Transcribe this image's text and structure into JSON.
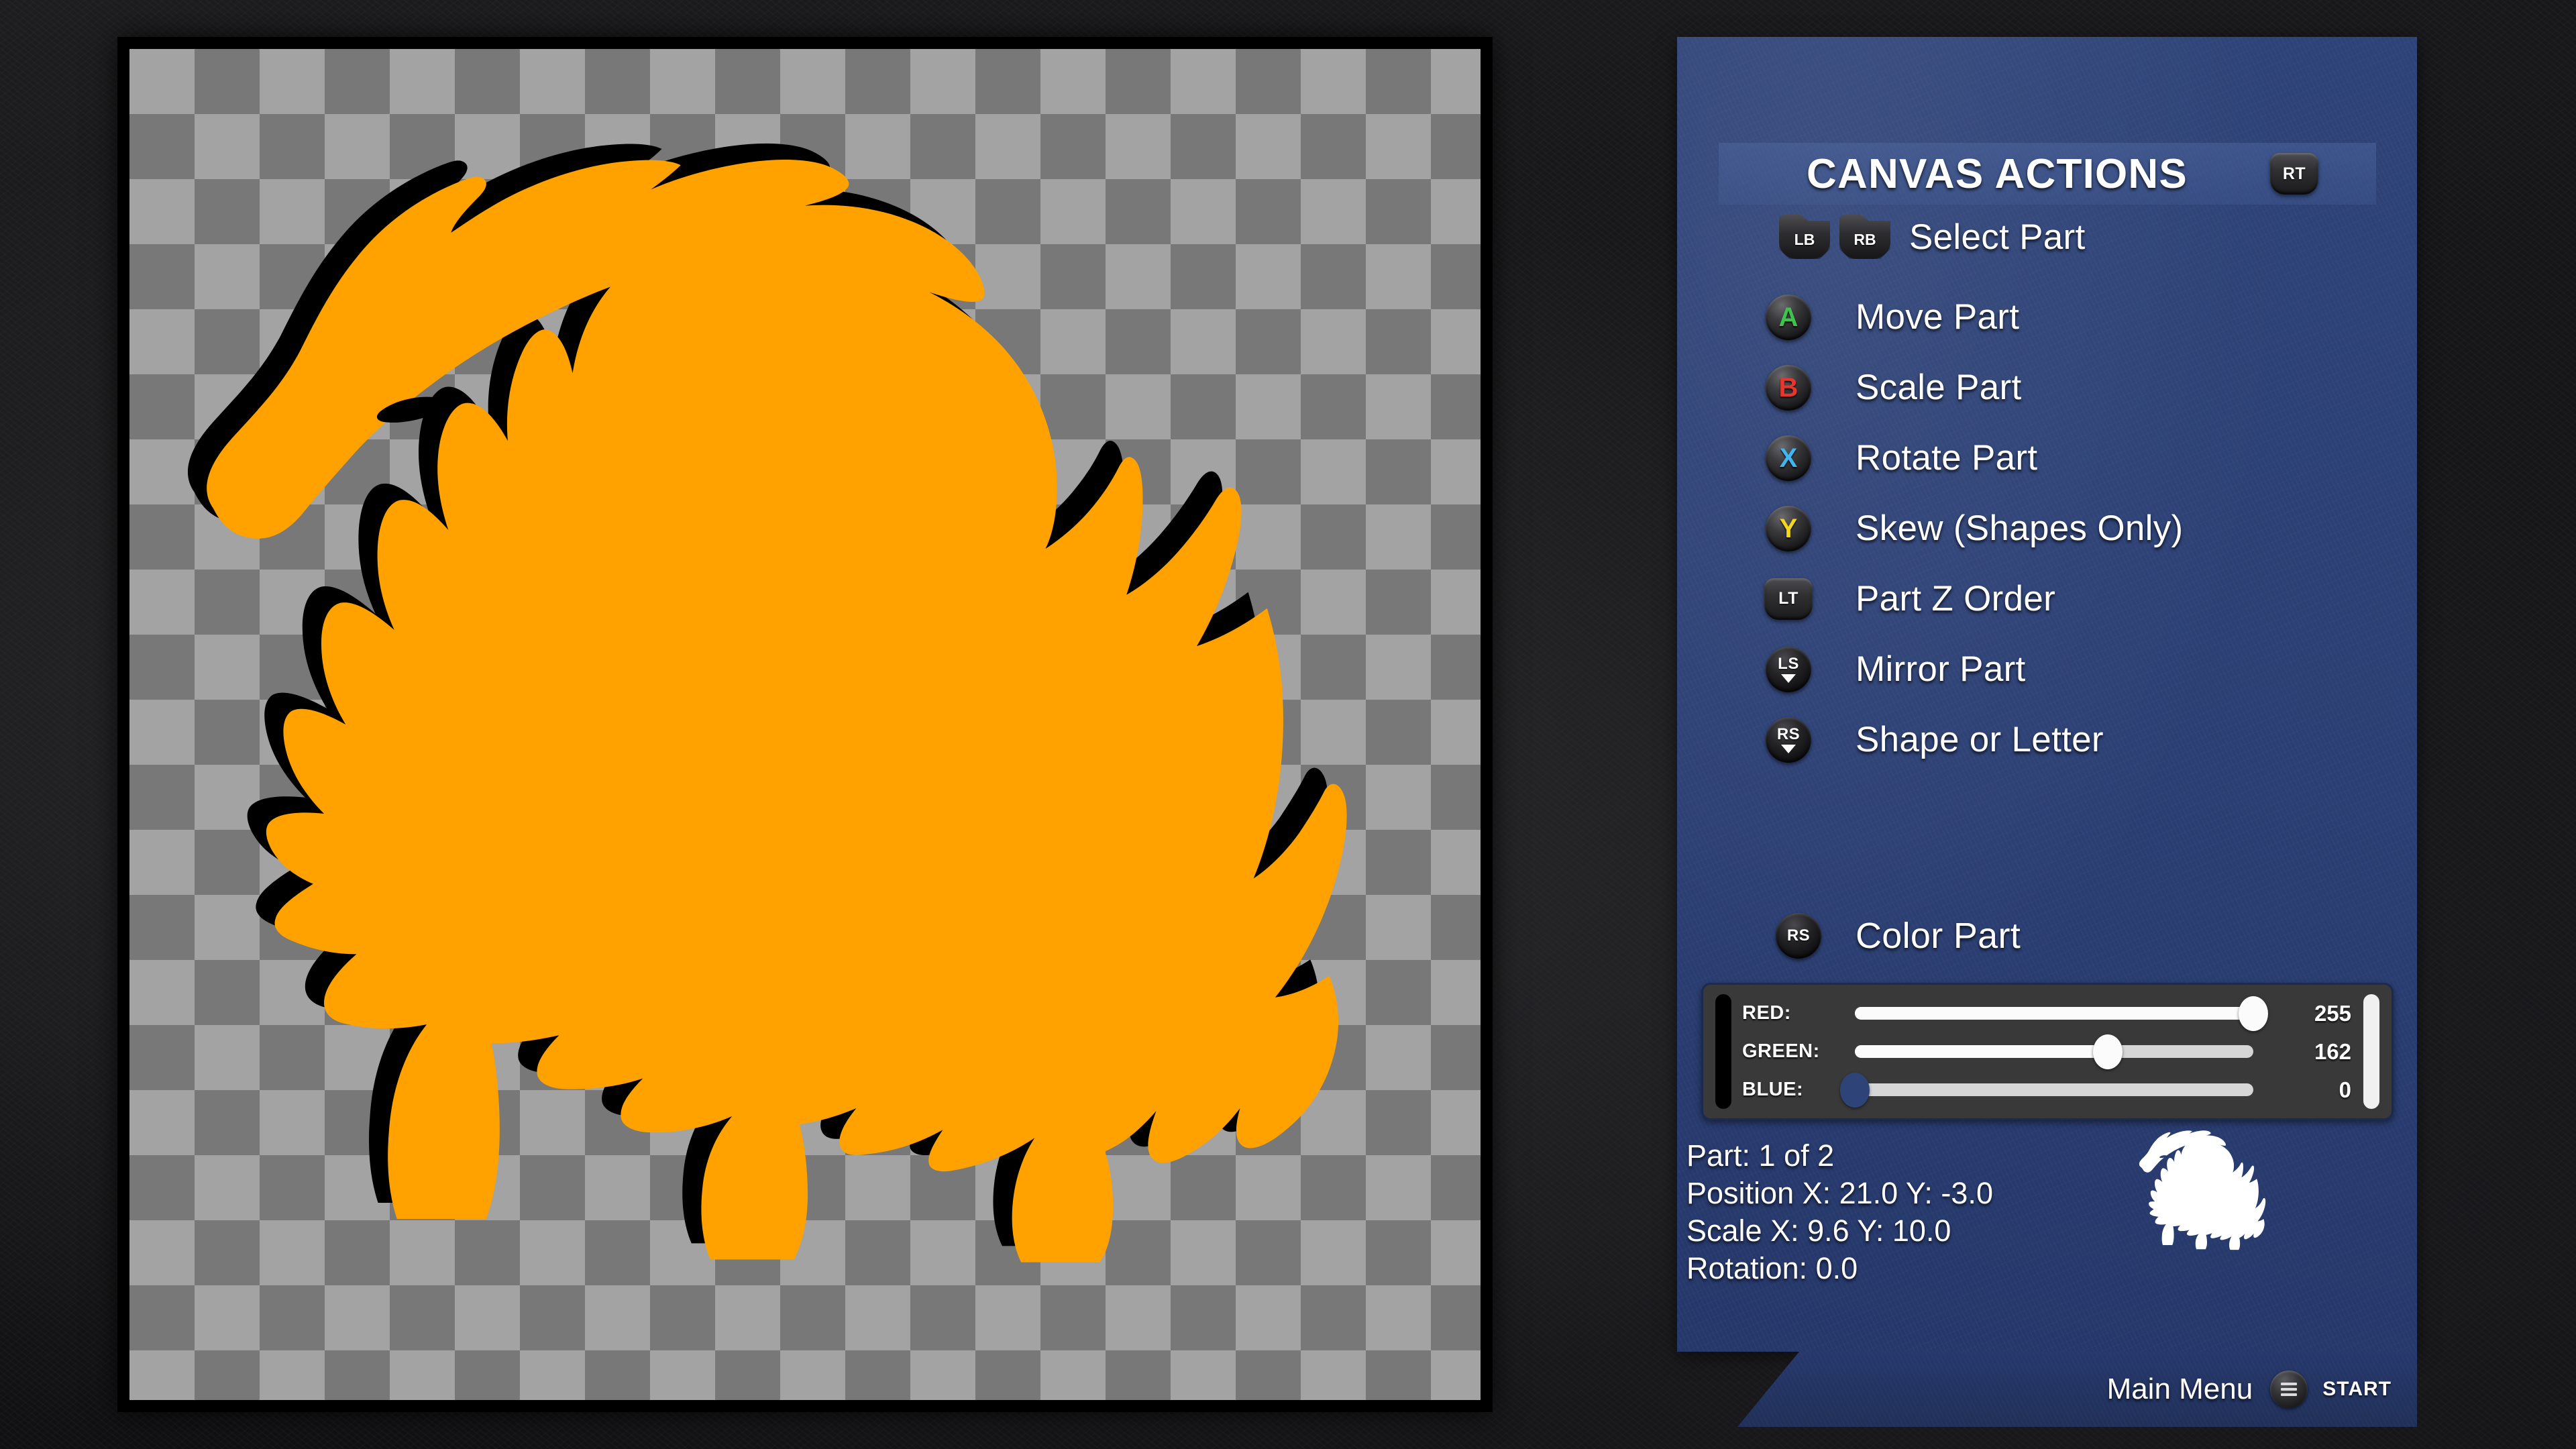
{
  "app": {
    "background_color": "#141416"
  },
  "canvas": {
    "name": "design-canvas",
    "checker_light": "#a3a3a3",
    "checker_dark": "#787878",
    "border_color": "#000000",
    "artwork_name": "lion-logo-artwork",
    "part_fill_color": "#ffa200",
    "part_outline_color": "#000000"
  },
  "hud": {
    "title": "CANVAS ACTIONS",
    "title_button": {
      "label": "RT",
      "icon": "trigger-rt-icon"
    },
    "panel_color": "#2b3f74",
    "select_part": {
      "label": "Select Part",
      "buttons": [
        {
          "label": "LB",
          "icon": "bumper-lb-icon"
        },
        {
          "label": "RB",
          "icon": "bumper-rb-icon"
        }
      ]
    },
    "actions": [
      {
        "label": "Move Part",
        "button": "A",
        "icon": "button-a-icon",
        "style": "face-a",
        "kind": "round"
      },
      {
        "label": "Scale Part",
        "button": "B",
        "icon": "button-b-icon",
        "style": "face-b",
        "kind": "round"
      },
      {
        "label": "Rotate Part",
        "button": "X",
        "icon": "button-x-icon",
        "style": "face-x",
        "kind": "round"
      },
      {
        "label": "Skew (Shapes Only)",
        "button": "Y",
        "icon": "button-y-icon",
        "style": "face-y",
        "kind": "round"
      },
      {
        "label": "Part Z Order",
        "button": "LT",
        "icon": "trigger-lt-icon",
        "style": "",
        "kind": "trigger"
      },
      {
        "label": "Mirror Part",
        "button": "LS",
        "icon": "stick-ls-icon",
        "style": "",
        "kind": "stick"
      },
      {
        "label": "Shape or Letter",
        "button": "RS",
        "icon": "stick-rs-icon",
        "style": "",
        "kind": "stick"
      }
    ],
    "color_part": {
      "label": "Color Part",
      "button": "RS",
      "icon": "stick-rs-icon",
      "channels": [
        {
          "name": "RED:",
          "value": 255,
          "max": 255,
          "knob_color": "#fbfbfb"
        },
        {
          "name": "GREEN:",
          "value": 162,
          "max": 255,
          "knob_color": "#fbfbfb"
        },
        {
          "name": "BLUE:",
          "value": 0,
          "max": 255,
          "knob_color": "#2e4378"
        }
      ]
    },
    "part_info": [
      "Part: 1 of 2",
      "Position X: 21.0  Y: -3.0",
      "Scale X: 9.6  Y: 10.0",
      "Rotation: 0.0"
    ],
    "brand_mark": "lion-silhouette-icon",
    "footer": {
      "menu_label": "Main Menu",
      "start_label": "START",
      "start_icon": "start-button-icon"
    }
  }
}
